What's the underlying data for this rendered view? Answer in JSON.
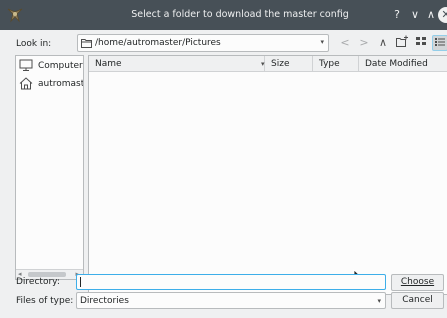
{
  "window": {
    "title": "Select a folder to download the master config",
    "help_glyph": "?",
    "minimize_glyph": "∨",
    "maximize_glyph": "∧",
    "close_glyph": "✕",
    "app_icon": "app-icon"
  },
  "toolbar": {
    "look_in_label": "Look in:",
    "path_value": "/home/autromaster/Pictures",
    "combo_arrow": "▾",
    "back_glyph": "<",
    "forward_glyph": ">",
    "up_glyph": "∧",
    "icons": [
      "back-icon",
      "forward-icon",
      "up-icon",
      "new-folder-icon",
      "list-view-icon",
      "detail-view-icon"
    ]
  },
  "sidebar": {
    "items": [
      {
        "label": "Computer",
        "icon": "computer-icon"
      },
      {
        "label": "autromast",
        "icon": "home-icon"
      }
    ],
    "scroll_left": "◂",
    "scroll_right": "▸"
  },
  "filelist": {
    "columns": [
      "Name",
      "Size",
      "Type",
      "Date Modified"
    ],
    "sort_indicator": "▾",
    "rows": []
  },
  "footer": {
    "directory_label": "Directory:",
    "directory_value": "",
    "choose_label": "Choose",
    "files_of_type_label": "Files of type:",
    "files_of_type_value": "Directories",
    "combo_arrow": "▾",
    "cancel_label": "Cancel"
  },
  "colors": {
    "titlebar": "#475057",
    "window_bg": "#eff0f1",
    "field_bg": "#fcfcfc",
    "focus_border": "#3daee9"
  }
}
